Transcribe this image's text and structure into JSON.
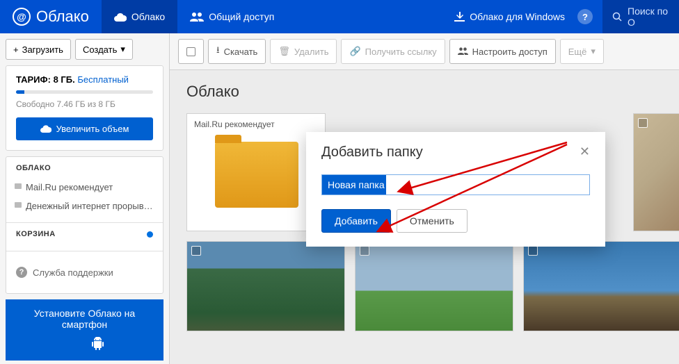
{
  "header": {
    "logo": "Облако",
    "nav_cloud": "Облако",
    "nav_shared": "Общий доступ",
    "nav_windows": "Облако для Windows",
    "search_placeholder": "Поиск по О"
  },
  "sidebar": {
    "upload": "Загрузить",
    "create": "Создать",
    "tariff_label": "ТАРИФ:",
    "tariff_size": "8 ГБ.",
    "tariff_plan": "Бесплатный",
    "storage_free": "Свободно 7.46 ГБ из 8 ГБ",
    "increase": "Увеличить объем",
    "section_cloud": "ОБЛАКО",
    "link_recommend": "Mail.Ru рекомендует",
    "link_money": "Денежный интернет прорыв ...",
    "section_trash": "КОРЗИНА",
    "support": "Служба поддержки",
    "smartphone": "Установите Облако на смартфон"
  },
  "toolbar": {
    "download": "Скачать",
    "delete": "Удалить",
    "get_link": "Получить ссылку",
    "configure_access": "Настроить доступ",
    "more": "Ещё"
  },
  "content": {
    "title": "Облако",
    "thumb_recommend": "Mail.Ru рекомендует"
  },
  "dialog": {
    "title": "Добавить папку",
    "input_value": "Новая папка",
    "add": "Добавить",
    "cancel": "Отменить"
  }
}
